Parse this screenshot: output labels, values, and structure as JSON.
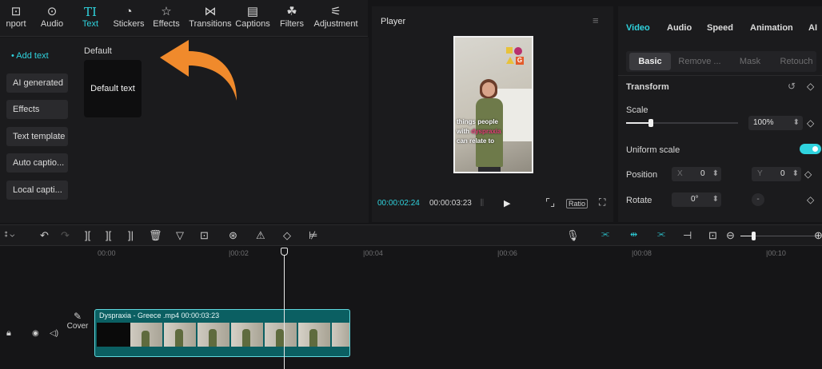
{
  "toolbar": {
    "tabs": [
      {
        "label": "nport",
        "icon": "import-icon"
      },
      {
        "label": "Audio",
        "icon": "audio-icon"
      },
      {
        "label": "Text",
        "icon": "text-icon",
        "active": true
      },
      {
        "label": "Stickers",
        "icon": "stickers-icon"
      },
      {
        "label": "Effects",
        "icon": "effects-icon"
      },
      {
        "label": "Transitions",
        "icon": "transitions-icon"
      },
      {
        "label": "Captions",
        "icon": "captions-icon"
      },
      {
        "label": "Filters",
        "icon": "filters-icon"
      },
      {
        "label": "Adjustment",
        "icon": "adjustment-icon"
      }
    ]
  },
  "text_sidebar": {
    "items": [
      "• Add text",
      "AI generated",
      "Effects",
      "Text template",
      "Auto captio...",
      "Local capti..."
    ]
  },
  "text_content": {
    "section_title": "Default",
    "card_label": "Default text"
  },
  "player": {
    "title": "Player",
    "current_time": "00:00:02:24",
    "total_time": "00:00:03:23",
    "ratio_label": "Ratio",
    "overlay_text": {
      "line1": "things people",
      "line2_a": "with ",
      "line2_b": "dyspraxia",
      "line3": "can relate to"
    }
  },
  "inspector": {
    "tabs": [
      "Video",
      "Audio",
      "Speed",
      "Animation",
      "AI"
    ],
    "subtabs": [
      "Basic",
      "Remove ...",
      "Mask",
      "Retouch"
    ],
    "transform_title": "Transform",
    "scale_label": "Scale",
    "scale_value": "100%",
    "scale_level": 0.22,
    "uniform_scale_label": "Uniform scale",
    "uniform_scale_on": true,
    "position_label": "Position",
    "pos_x_axis": "X",
    "pos_x": "0",
    "pos_y_axis": "Y",
    "pos_y": "0",
    "rotate_label": "Rotate",
    "rotate_value": "0°"
  },
  "timeline": {
    "ruler_ticks": [
      "00:00",
      "|00:02",
      "|00:04",
      "|00:06",
      "|00:08",
      "|00:10"
    ],
    "clip_label": "Dyspraxia - Greece .mp4  00:00:03:23",
    "cover_label": "Cover"
  },
  "colors": {
    "accent": "#2fd3de",
    "arrow": "#f08a2c",
    "clip": "#0b5f62"
  }
}
